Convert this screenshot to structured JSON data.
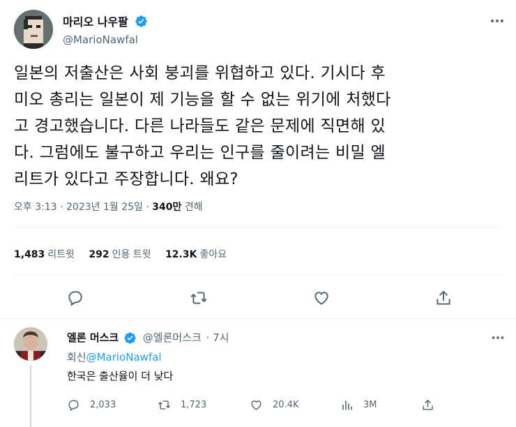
{
  "tweet": {
    "author_name": "마리오 나우팔",
    "author_handle": "@MarioNawfal",
    "text": "일본의 저출산은 사회 붕괴를 위협하고 있다. 기시다 후\n미오 총리는 일본이 제 기능을 할 수 없는 위기에 처했다\n고 경고했습니다. 다른 나라들도 같은 문제에 직면해 있\n다. 그럼에도 불구하고 우리는 인구를 줄이려는 비밀 엘\n리트가 있다고 주장합니다. 왜요?",
    "time": "오후 3:13",
    "date": "2023년 1월 25일",
    "separator": "·",
    "views_count": "340만",
    "views_label": "견해",
    "stats": [
      {
        "count": "1,483",
        "label": "리트윗"
      },
      {
        "count": "292",
        "label": "인용 트윗"
      },
      {
        "count": "12.3K",
        "label": "좋아요"
      }
    ]
  },
  "reply": {
    "name": "엘론 머스크",
    "handle": "@엘론머스크",
    "age": "· 7시",
    "replying_prefix": "회신",
    "replying_to": "@MarioNawfal",
    "text": "한국은 출산율이 더 낮다",
    "counts": {
      "reply": "2,033",
      "retweet": "1,723",
      "like": "20.4K",
      "views": "3M"
    }
  },
  "colors": {
    "accent": "#1d9bf0",
    "muted": "#536471",
    "text": "#0f1419",
    "divider": "#eff3f4"
  },
  "icons": [
    "verified-badge-icon",
    "more-icon",
    "reply-icon",
    "retweet-icon",
    "like-icon",
    "share-icon",
    "views-icon"
  ]
}
